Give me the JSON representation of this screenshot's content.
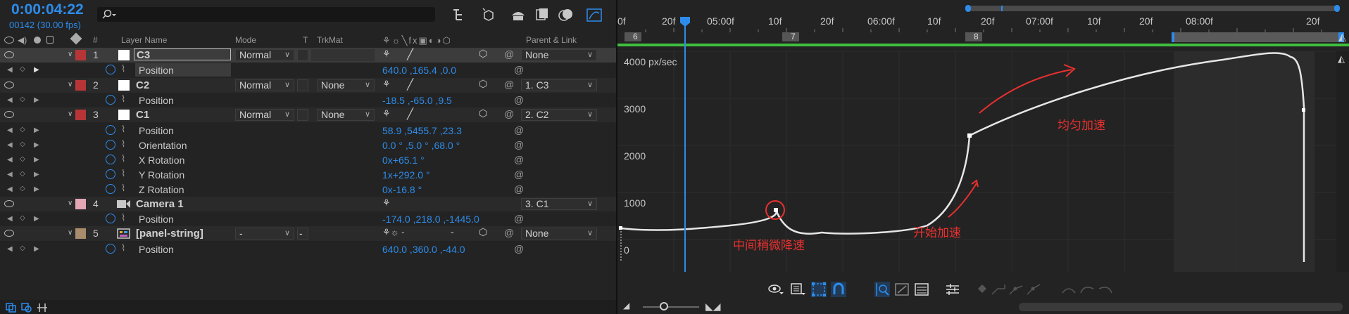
{
  "header": {
    "timecode": "0:00:04:22",
    "fps": "00142 (30.00 fps)"
  },
  "columns": {
    "num": "#",
    "layer_name": "Layer Name",
    "mode": "Mode",
    "t": "T",
    "trkmat": "TrkMat",
    "parent": "Parent & Link"
  },
  "layers": [
    {
      "num": "1",
      "name": "C3",
      "color": "#b73537",
      "mode": "Normal",
      "trkmat": "",
      "parent": "None"
    },
    {
      "num": "2",
      "name": "C2",
      "color": "#b73537",
      "mode": "Normal",
      "trkmat": "None",
      "parent": "1. C3"
    },
    {
      "num": "3",
      "name": "C1",
      "color": "#b73537",
      "mode": "Normal",
      "trkmat": "None",
      "parent": "2. C2"
    },
    {
      "num": "4",
      "name": "Camera 1",
      "color": "#e2a6b4",
      "mode": "",
      "trkmat": "",
      "parent": "3. C1"
    },
    {
      "num": "5",
      "name": "[panel-string]",
      "color": "#a88c6b",
      "mode": "-",
      "trkmat": "-",
      "parent": "None"
    }
  ],
  "props": {
    "c3_position": {
      "name": "Position",
      "value": "640.0 ,165.4 ,0.0"
    },
    "c2_position": {
      "name": "Position",
      "value": "-18.5 ,-65.0 ,9.5"
    },
    "c1_position": {
      "name": "Position",
      "value": "58.9 ,5455.7 ,23.3"
    },
    "c1_orientation": {
      "name": "Orientation",
      "value": "0.0 ° ,5.0 ° ,68.0 °"
    },
    "c1_xrot": {
      "name": "X Rotation",
      "value": "0x+65.1 °"
    },
    "c1_yrot": {
      "name": "Y Rotation",
      "value": "1x+292.0 °"
    },
    "c1_zrot": {
      "name": "Z Rotation",
      "value": "0x-16.8 °"
    },
    "cam_position": {
      "name": "Position",
      "value": "-174.0 ,218.0 ,-1445.0"
    },
    "panel_position": {
      "name": "Position",
      "value": "640.0 ,360.0 ,-44.0"
    }
  },
  "ruler": {
    "labels": [
      "0f",
      "20f",
      "05:00f",
      "10f",
      "20f",
      "06:00f",
      "10f",
      "20f",
      "07:00f",
      "10f",
      "20f",
      "08:00f",
      "20f"
    ],
    "markers": [
      "6",
      "7",
      "8"
    ]
  },
  "graph": {
    "y_labels": [
      "4000 px/sec",
      "3000",
      "2000",
      "1000",
      "0"
    ],
    "annotations": {
      "slight_decel": "中间稍微降速",
      "start_accel": "开始加速",
      "uniform_accel": "均匀加速"
    }
  },
  "colors": {
    "accent": "#2d8ceb",
    "annotation": "#e8312f",
    "workarea": "#3fbf3f"
  }
}
